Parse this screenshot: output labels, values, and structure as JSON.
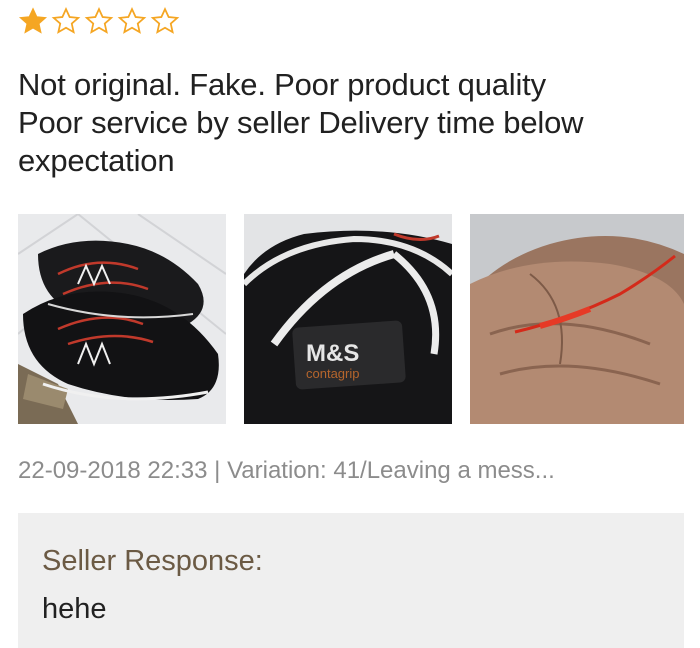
{
  "rating": {
    "value": 1,
    "max": 5,
    "filled_color": "#f5a623",
    "empty_color": "#f5a623"
  },
  "review": {
    "lines": [
      "Not original. Fake. Poor product quality",
      "Poor service by seller  Delivery time below",
      "expectation"
    ]
  },
  "photos": [
    {
      "name": "shoes-pair-photo"
    },
    {
      "name": "shoe-closeup-logo-photo",
      "logo_line1": "M&S",
      "logo_line2": "contagrip"
    },
    {
      "name": "red-lace-in-hand-photo"
    }
  ],
  "meta": {
    "text": "22-09-2018 22:33 | Variation: 41/Leaving a mess..."
  },
  "seller_response": {
    "title": "Seller Response:",
    "reply": "hehe"
  },
  "colors": {
    "meta_text": "#8c8c8c",
    "seller_title": "#6b5a44",
    "seller_bg": "#efefef"
  }
}
